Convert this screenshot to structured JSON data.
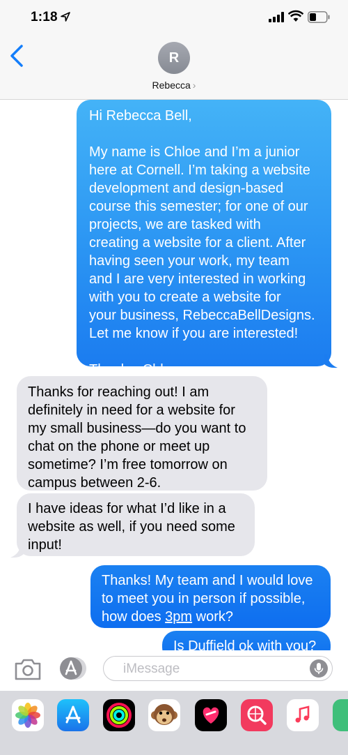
{
  "status": {
    "time": "1:18"
  },
  "header": {
    "avatar_initial": "R",
    "contact_name": "Rebecca",
    "chevron": "›"
  },
  "messages": [
    {
      "sender": "me",
      "text": "Hi Rebecca Bell,\n\nMy name is Chloe and I’m a junior\nhere at Cornell. I’m taking a website\ndevelopment and design-based\ncourse this semester; for one of our\nprojects, we are tasked with\ncreating a website for a client. After\nhaving seen your work, my team\nand I are very interested in working\nwith you to create a website for\nyour business, RebeccaBellDesigns.\nLet me know if you are interested!\n\nThanks, Chloe"
    },
    {
      "sender": "them",
      "text": "Thanks for reaching out! I am\ndefinitely in need for a website for\nmy small business—do you want to\nchat on the phone or meet up\nsometime? I’m free tomorrow on\ncampus between 2-6."
    },
    {
      "sender": "them",
      "text": "I have ideas for what I’d like in a\nwebsite as well, if you need some\ninput!"
    },
    {
      "sender": "me",
      "text_parts": [
        "Thanks! My team and I would love\nto meet you in person if possible,\nhow does ",
        "3pm",
        " work?"
      ]
    },
    {
      "sender": "me",
      "text": "Is Duffield ok with you?"
    }
  ],
  "composer": {
    "placeholder": "iMessage"
  },
  "icons": {
    "back": "chevron-left-icon",
    "camera": "camera-icon",
    "apps": "app-store-icon",
    "mic": "microphone-icon"
  },
  "drawer_apps": [
    "photos-icon",
    "app-store-icon",
    "activity-icon",
    "monkey-emoji-icon",
    "digital-touch-icon",
    "web-search-icon",
    "music-icon",
    "more-app-icon"
  ],
  "colors": {
    "outgoing_top": "#44b3f7",
    "outgoing_bottom": "#1b7cf0",
    "incoming": "#e6e6eb",
    "accent": "#147efb"
  }
}
